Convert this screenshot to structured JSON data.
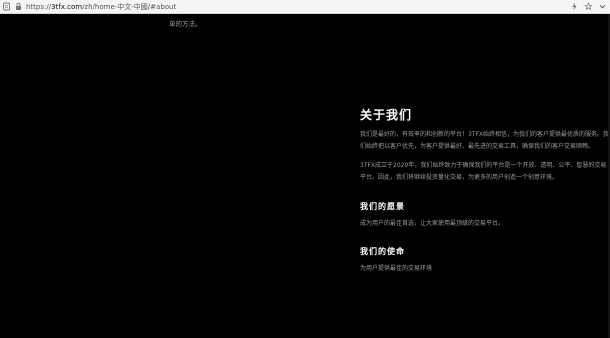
{
  "browser": {
    "url_scheme": "https://",
    "url_host": "3tfx.com",
    "url_path": "/zh/home-中文-中國/#about"
  },
  "page": {
    "scroll_residue": "单的方法。",
    "about": {
      "title": "关于我们",
      "para1": "我们是最好的，有效率的和创新的平台！3TFX始终相信，为我们的客户提供最优质的服务。我们始终把以客户优先，为客户提供最好、最先进的交易工具，确保我们的客户交易顺畅。",
      "para2": "3TFX成立于2020年，我们始终致力于确保我们的平台是一个开放、透明、公平、智慧的交易平台。因此，我们将继续投资量化交易，为更多的用户创造一个创意环境。",
      "vision_title": "我们的愿景",
      "vision_text": "成为用户的最佳首选，让大家使用最顶级的交易平台。",
      "mission_title": "我们的使命",
      "mission_text": "为用户提供最佳的交易环境"
    }
  }
}
